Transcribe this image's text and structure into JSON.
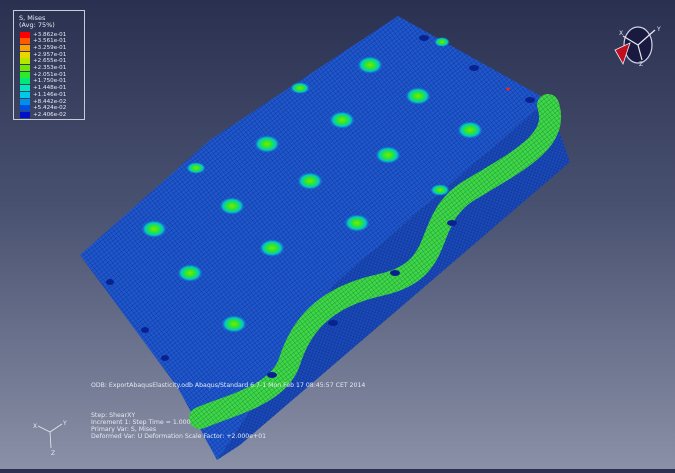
{
  "legend": {
    "title": "S, Mises",
    "subtitle": "(Avg: 75%)",
    "entries": [
      {
        "label": "+3.862e-01",
        "color": "#ff0000"
      },
      {
        "label": "+3.561e-01",
        "color": "#ff5a00"
      },
      {
        "label": "+3.259e-01",
        "color": "#ffa000"
      },
      {
        "label": "+2.957e-01",
        "color": "#e8d800"
      },
      {
        "label": "+2.655e-01",
        "color": "#b4e600"
      },
      {
        "label": "+2.353e-01",
        "color": "#6ee800"
      },
      {
        "label": "+2.051e-01",
        "color": "#2ee82a"
      },
      {
        "label": "+1.750e-01",
        "color": "#00e87a"
      },
      {
        "label": "+1.448e-01",
        "color": "#00e6c0"
      },
      {
        "label": "+1.146e-01",
        "color": "#00c8e8"
      },
      {
        "label": "+8.442e-02",
        "color": "#0090e8"
      },
      {
        "label": "+5.424e-02",
        "color": "#0050e0"
      },
      {
        "label": "+2.406e-02",
        "color": "#0010c8"
      }
    ]
  },
  "info": {
    "odb_line": "ODB: ExportAbaqusElasticity.odb    Abaqus/Standard 6.7-1    Mon Feb 17 08:45:57 CET 2014",
    "step_line": "Step: ShearXY",
    "increment_line": "Increment      1: Step Time =      1.000",
    "primary_line": "Primary Var: S, Mises",
    "deformed_line": "Deformed Var: U   Deformation Scale Factor: +2.000e+01"
  },
  "triad": {
    "x": "X",
    "y": "Y",
    "z": "Z"
  },
  "view_cube": {
    "x": "X",
    "y": "Y",
    "z": "Z"
  },
  "colors": {
    "mesh_base": "#1e55c8",
    "mesh_dark": "#0a2a90",
    "band": "#3ed84a"
  }
}
